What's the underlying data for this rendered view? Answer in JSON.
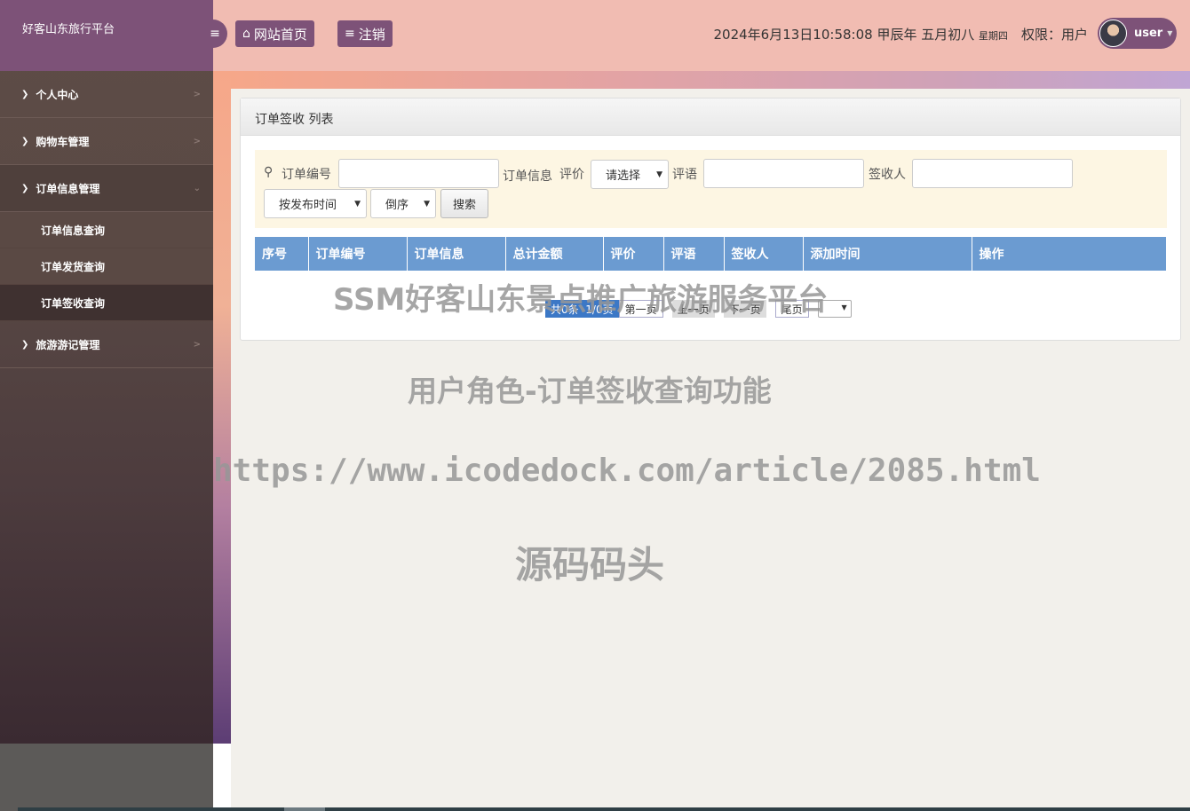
{
  "sidebar": {
    "brand": "好客山东旅行平台",
    "items": [
      {
        "label": "个人中心"
      },
      {
        "label": "购物车管理"
      },
      {
        "label": "订单信息管理"
      },
      {
        "label": "旅游游记管理"
      }
    ],
    "subitems": [
      {
        "label": "订单信息查询"
      },
      {
        "label": "订单发货查询"
      },
      {
        "label": "订单签收查询"
      }
    ]
  },
  "header": {
    "home_label": "网站首页",
    "logout_label": "注销",
    "datetime": "2024年6月13日10:58:08 甲辰年 五月初八",
    "weekday": "星期四",
    "permission": "权限：用户",
    "username": "user"
  },
  "panel": {
    "title": "订单签收 列表",
    "search": {
      "order_no_label": "订单编号",
      "order_info_label": "订单信息",
      "rating_label": "评价",
      "rating_select": "请选择",
      "comment_label": "评语",
      "receiver_label": "签收人",
      "sort_select": "按发布时间",
      "order_select": "倒序",
      "search_button": "搜索"
    },
    "columns": [
      "序号",
      "订单编号",
      "订单信息",
      "总计金额",
      "评价",
      "评语",
      "签收人",
      "添加时间",
      "操作"
    ],
    "pager": {
      "total": "共0条",
      "pages": "1/0页",
      "first": "第一页",
      "prev": "上一页",
      "next": "下一页",
      "last": "尾页"
    }
  },
  "watermarks": {
    "line1": "SSM好客山东景点推广旅游服务平台",
    "line2": "用户角色-订单签收查询功能",
    "line3": "https://www.icodedock.com/article/2085.html",
    "line4": "源码码头"
  }
}
